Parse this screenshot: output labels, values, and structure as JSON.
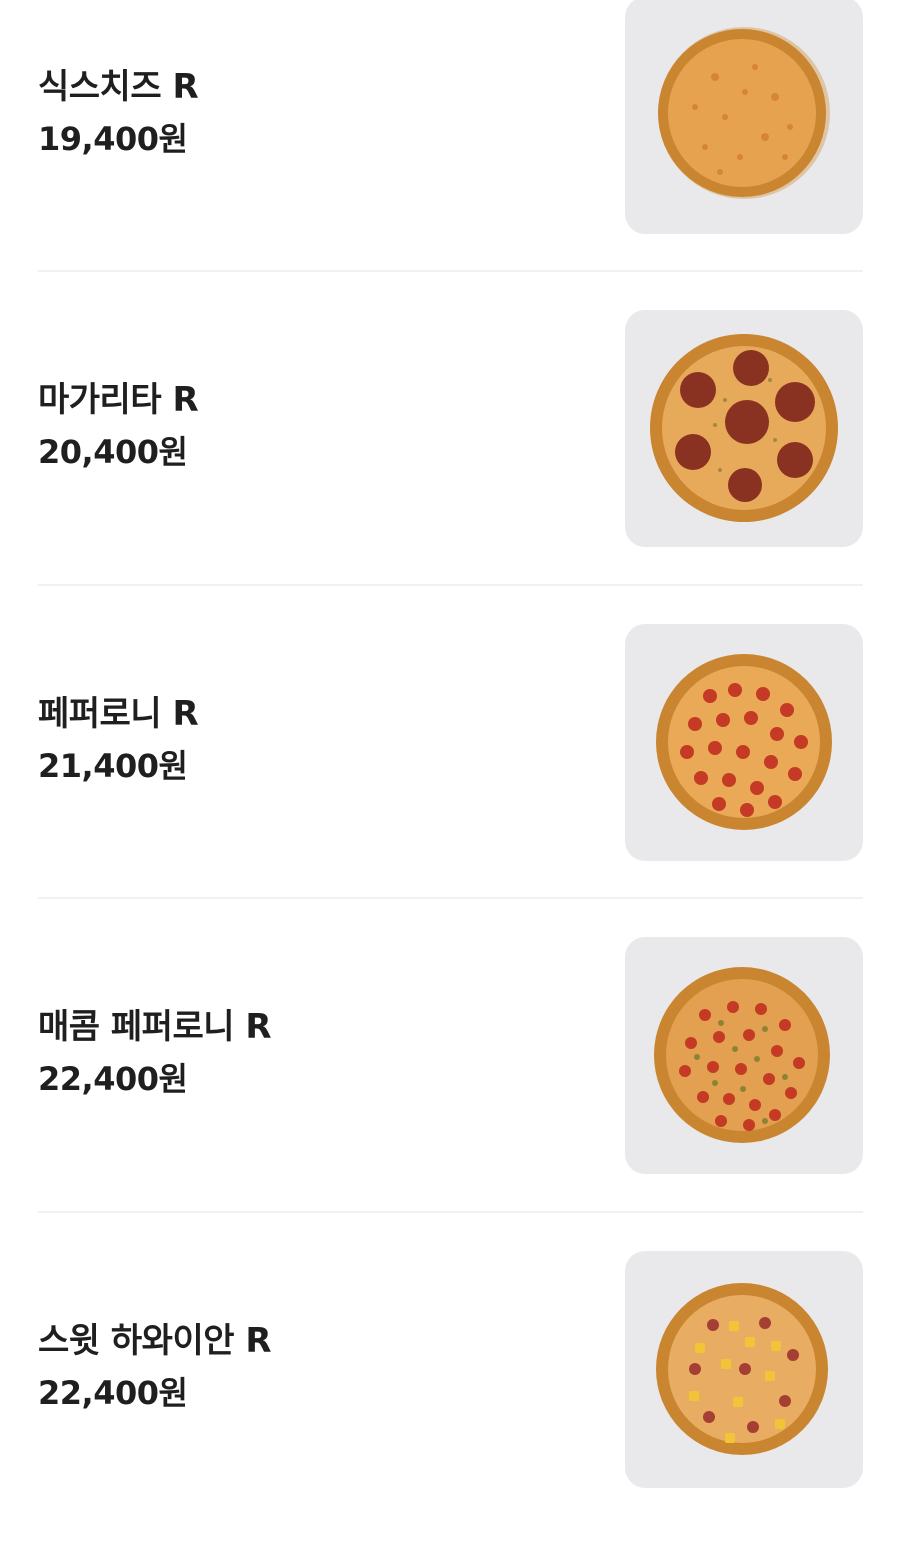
{
  "menu": {
    "items": [
      {
        "name": "식스치즈 R",
        "price": "19,400원",
        "image_icon": "six-cheese-pizza-icon",
        "topping": "cheese"
      },
      {
        "name": "마가리타 R",
        "price": "20,400원",
        "image_icon": "margherita-pizza-icon",
        "topping": "salami"
      },
      {
        "name": "페퍼로니 R",
        "price": "21,400원",
        "image_icon": "pepperoni-pizza-icon",
        "topping": "pepperoni"
      },
      {
        "name": "매콤 페퍼로니 R",
        "price": "22,400원",
        "image_icon": "spicy-pepperoni-pizza-icon",
        "topping": "spicy"
      },
      {
        "name": "스윗 하와이안 R",
        "price": "22,400원",
        "image_icon": "sweet-hawaiian-pizza-icon",
        "topping": "hawaiian"
      }
    ]
  },
  "colors": {
    "text": "#1f1f1f",
    "thumb_bg": "#e9e9eb",
    "divider": "#f1f1f3",
    "crust": "#c9852f",
    "cheese": "#e7a04a",
    "pepperoni": "#c43a24",
    "salami": "#8a3222",
    "pineapple": "#f2c437"
  }
}
